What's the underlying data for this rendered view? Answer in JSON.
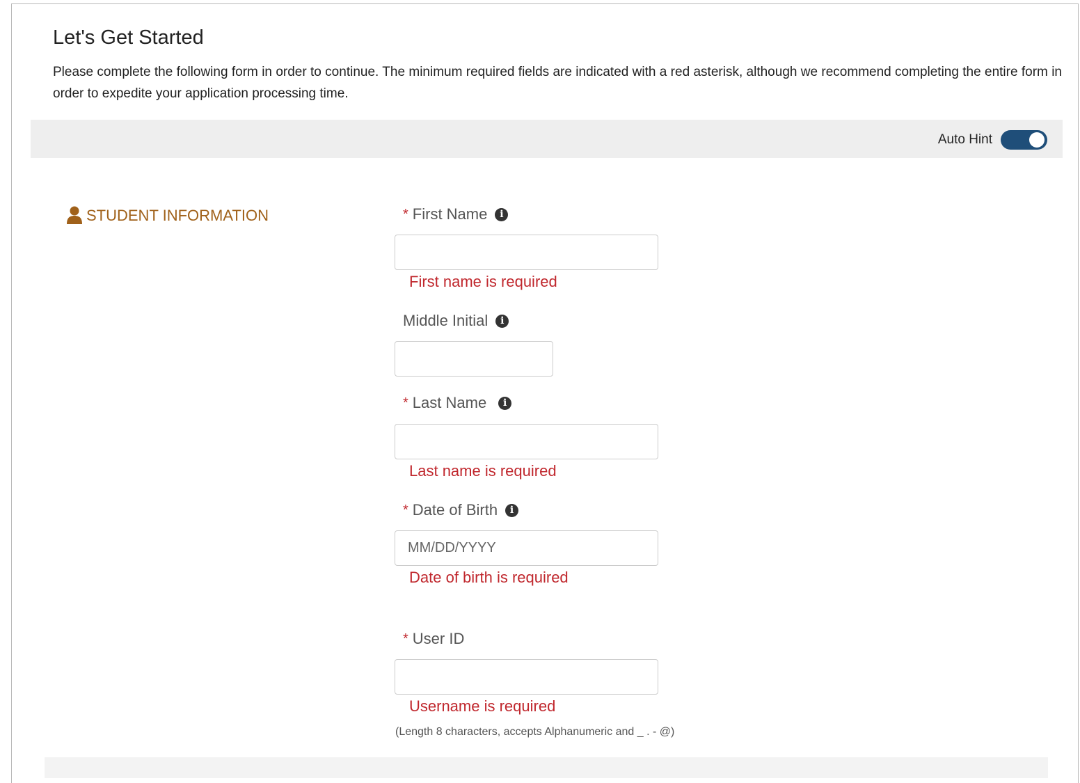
{
  "page": {
    "title": "Let's Get Started",
    "intro": "Please complete the following form in order to continue. The minimum required fields are indicated with a red asterisk, although we recommend completing the entire form in order to expedite your application processing time."
  },
  "hint_bar": {
    "label": "Auto Hint",
    "toggle_on": true,
    "toggle_color": "#1f4e79"
  },
  "section": {
    "icon": "user-icon",
    "title": "STUDENT INFORMATION",
    "color": "#a0611a"
  },
  "fields": {
    "first_name": {
      "required_mark": "*",
      "label": "First Name",
      "value": "",
      "error": "First name is required",
      "info_icon": "i"
    },
    "middle_initial": {
      "label": "Middle Initial",
      "value": "",
      "info_icon": "i"
    },
    "last_name": {
      "required_mark": "*",
      "label": "Last Name",
      "value": "",
      "error": "Last name is required",
      "info_icon": "i"
    },
    "dob": {
      "required_mark": "*",
      "label": "Date of Birth",
      "value": "",
      "placeholder": "MM/DD/YYYY",
      "error": "Date of birth is required",
      "info_icon": "i"
    },
    "user_id": {
      "required_mark": "*",
      "label": "User ID",
      "value": "",
      "error": "Username is required",
      "helper": "(Length 8 characters, accepts Alphanumeric and _ . - @)"
    }
  },
  "colors": {
    "error": "#c0272d",
    "accent": "#1f4e79"
  }
}
